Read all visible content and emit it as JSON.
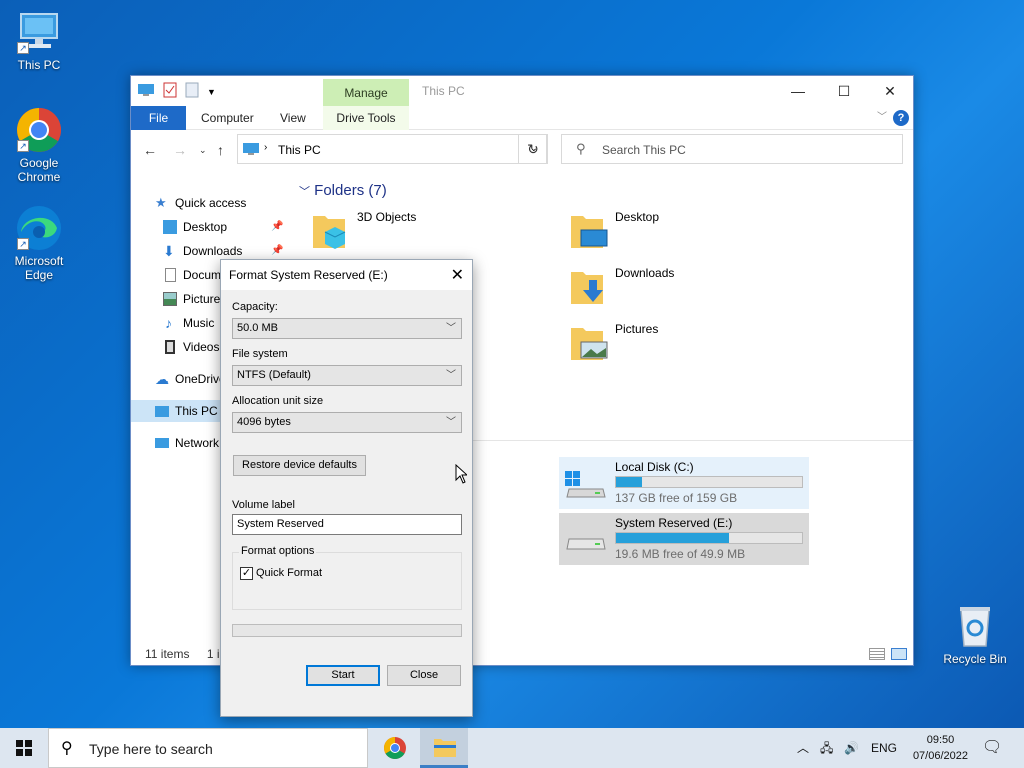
{
  "desktop": {
    "icons": [
      {
        "label": "This PC"
      },
      {
        "label": "Google Chrome"
      },
      {
        "label": "Microsoft Edge"
      },
      {
        "label": "Recycle Bin"
      }
    ]
  },
  "explorer": {
    "title": "This PC",
    "contextual_tab": "Manage",
    "ribbon_tabs": {
      "file": "File",
      "computer": "Computer",
      "view": "View",
      "drive_tools": "Drive Tools"
    },
    "address": "This PC",
    "search_placeholder": "Search This PC",
    "sidebar": [
      {
        "label": "Quick access"
      },
      {
        "label": "Desktop"
      },
      {
        "label": "Downloads"
      },
      {
        "label": "Documents"
      },
      {
        "label": "Pictures"
      },
      {
        "label": "Music"
      },
      {
        "label": "Videos"
      },
      {
        "label": "OneDrive"
      },
      {
        "label": "This PC"
      },
      {
        "label": "Network"
      }
    ],
    "folders_header": "Folders (7)",
    "folders": [
      {
        "name": "3D Objects"
      },
      {
        "name": "Desktop"
      },
      {
        "name": "Downloads"
      },
      {
        "name": "Pictures"
      }
    ],
    "drives": [
      {
        "name": "Local Disk (C:)",
        "free": "137 GB free of 159 GB",
        "used_fraction": 0.14
      },
      {
        "name": "System Reserved (E:)",
        "free": "19.6 MB free of 49.9 MB",
        "used_fraction": 0.61
      }
    ],
    "status": {
      "items": "11 items",
      "selected": "1 i"
    }
  },
  "format_dialog": {
    "title": "Format System Reserved (E:)",
    "capacity_label": "Capacity:",
    "capacity_value": "50.0 MB",
    "filesystem_label": "File system",
    "filesystem_value": "NTFS (Default)",
    "alloc_label": "Allocation unit size",
    "alloc_value": "4096 bytes",
    "restore_button": "Restore device defaults",
    "volume_label": "Volume label",
    "volume_value": "System Reserved",
    "format_options_label": "Format options",
    "quick_format_label": "Quick Format",
    "quick_format_checked": true,
    "start_button": "Start",
    "close_button": "Close"
  },
  "taskbar": {
    "search_placeholder": "Type here to search",
    "language": "ENG",
    "time": "09:50",
    "date": "07/06/2022"
  },
  "colors": {
    "accent": "#1e6ac8",
    "manage_tab": "#cdeeb5",
    "drive_bar": "#26a0da"
  }
}
